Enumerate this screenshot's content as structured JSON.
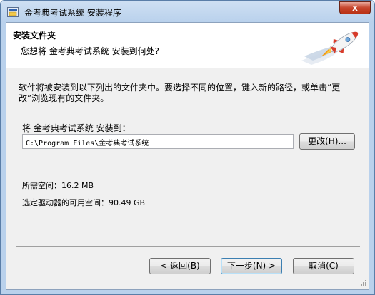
{
  "window": {
    "title": "金考典考试系统 安装程序",
    "close_label": "x"
  },
  "header": {
    "title": "安装文件夹",
    "subtitle": "您想将 金考典考试系统 安装到何处?"
  },
  "main": {
    "description": "软件将被安装到以下列出的文件夹中。要选择不同的位置，键入新的路径，或单击“更改”浏览现有的文件夹。",
    "install_to_label": "将 金考典考试系统 安装到：",
    "install_path": "C:\\Program Files\\金考典考试系统",
    "browse_label": "更改(H)...",
    "required_space": "所需空间：16.2 MB",
    "available_space": "选定驱动器的可用空间：90.49 GB"
  },
  "footer": {
    "back_label": "< 返回(B)",
    "next_label": "下一步(N) >",
    "cancel_label": "取消(C)"
  },
  "icons": {
    "app": "installer-app-icon",
    "header_graphic": "rocket-icon",
    "close": "close-icon"
  },
  "colors": {
    "titlebar": "#b9d1ec",
    "close_button": "#c7452c",
    "rocket_body": "#d73b2a"
  }
}
